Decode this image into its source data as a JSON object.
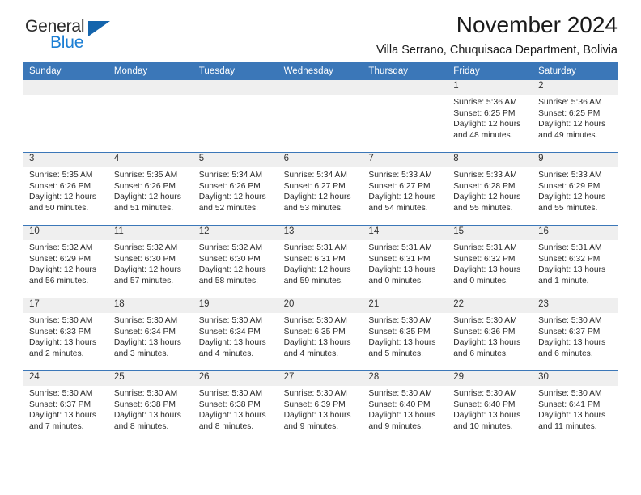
{
  "brand": {
    "name_primary": "General",
    "name_secondary": "Blue",
    "triangle": "triangle-logo-mark"
  },
  "header": {
    "title": "November 2024",
    "subtitle": "Villa Serrano, Chuquisaca Department, Bolivia"
  },
  "colors": {
    "header_blue": "#3b77b8",
    "brand_blue": "#1c7fd4",
    "triangle_blue": "#1464ac",
    "daynum_band": "#efefef",
    "text": "#1a1a1a"
  },
  "calendar": {
    "weekdays": [
      "Sunday",
      "Monday",
      "Tuesday",
      "Wednesday",
      "Thursday",
      "Friday",
      "Saturday"
    ],
    "weeks": [
      [
        {
          "day": "",
          "sunrise": "",
          "sunset": "",
          "daylight1": "",
          "daylight2": "",
          "empty": true
        },
        {
          "day": "",
          "sunrise": "",
          "sunset": "",
          "daylight1": "",
          "daylight2": "",
          "empty": true
        },
        {
          "day": "",
          "sunrise": "",
          "sunset": "",
          "daylight1": "",
          "daylight2": "",
          "empty": true
        },
        {
          "day": "",
          "sunrise": "",
          "sunset": "",
          "daylight1": "",
          "daylight2": "",
          "empty": true
        },
        {
          "day": "",
          "sunrise": "",
          "sunset": "",
          "daylight1": "",
          "daylight2": "",
          "empty": true
        },
        {
          "day": "1",
          "sunrise": "Sunrise: 5:36 AM",
          "sunset": "Sunset: 6:25 PM",
          "daylight1": "Daylight: 12 hours",
          "daylight2": "and 48 minutes."
        },
        {
          "day": "2",
          "sunrise": "Sunrise: 5:36 AM",
          "sunset": "Sunset: 6:25 PM",
          "daylight1": "Daylight: 12 hours",
          "daylight2": "and 49 minutes."
        }
      ],
      [
        {
          "day": "3",
          "sunrise": "Sunrise: 5:35 AM",
          "sunset": "Sunset: 6:26 PM",
          "daylight1": "Daylight: 12 hours",
          "daylight2": "and 50 minutes."
        },
        {
          "day": "4",
          "sunrise": "Sunrise: 5:35 AM",
          "sunset": "Sunset: 6:26 PM",
          "daylight1": "Daylight: 12 hours",
          "daylight2": "and 51 minutes."
        },
        {
          "day": "5",
          "sunrise": "Sunrise: 5:34 AM",
          "sunset": "Sunset: 6:26 PM",
          "daylight1": "Daylight: 12 hours",
          "daylight2": "and 52 minutes."
        },
        {
          "day": "6",
          "sunrise": "Sunrise: 5:34 AM",
          "sunset": "Sunset: 6:27 PM",
          "daylight1": "Daylight: 12 hours",
          "daylight2": "and 53 minutes."
        },
        {
          "day": "7",
          "sunrise": "Sunrise: 5:33 AM",
          "sunset": "Sunset: 6:27 PM",
          "daylight1": "Daylight: 12 hours",
          "daylight2": "and 54 minutes."
        },
        {
          "day": "8",
          "sunrise": "Sunrise: 5:33 AM",
          "sunset": "Sunset: 6:28 PM",
          "daylight1": "Daylight: 12 hours",
          "daylight2": "and 55 minutes."
        },
        {
          "day": "9",
          "sunrise": "Sunrise: 5:33 AM",
          "sunset": "Sunset: 6:29 PM",
          "daylight1": "Daylight: 12 hours",
          "daylight2": "and 55 minutes."
        }
      ],
      [
        {
          "day": "10",
          "sunrise": "Sunrise: 5:32 AM",
          "sunset": "Sunset: 6:29 PM",
          "daylight1": "Daylight: 12 hours",
          "daylight2": "and 56 minutes."
        },
        {
          "day": "11",
          "sunrise": "Sunrise: 5:32 AM",
          "sunset": "Sunset: 6:30 PM",
          "daylight1": "Daylight: 12 hours",
          "daylight2": "and 57 minutes."
        },
        {
          "day": "12",
          "sunrise": "Sunrise: 5:32 AM",
          "sunset": "Sunset: 6:30 PM",
          "daylight1": "Daylight: 12 hours",
          "daylight2": "and 58 minutes."
        },
        {
          "day": "13",
          "sunrise": "Sunrise: 5:31 AM",
          "sunset": "Sunset: 6:31 PM",
          "daylight1": "Daylight: 12 hours",
          "daylight2": "and 59 minutes."
        },
        {
          "day": "14",
          "sunrise": "Sunrise: 5:31 AM",
          "sunset": "Sunset: 6:31 PM",
          "daylight1": "Daylight: 13 hours",
          "daylight2": "and 0 minutes."
        },
        {
          "day": "15",
          "sunrise": "Sunrise: 5:31 AM",
          "sunset": "Sunset: 6:32 PM",
          "daylight1": "Daylight: 13 hours",
          "daylight2": "and 0 minutes."
        },
        {
          "day": "16",
          "sunrise": "Sunrise: 5:31 AM",
          "sunset": "Sunset: 6:32 PM",
          "daylight1": "Daylight: 13 hours",
          "daylight2": "and 1 minute."
        }
      ],
      [
        {
          "day": "17",
          "sunrise": "Sunrise: 5:30 AM",
          "sunset": "Sunset: 6:33 PM",
          "daylight1": "Daylight: 13 hours",
          "daylight2": "and 2 minutes."
        },
        {
          "day": "18",
          "sunrise": "Sunrise: 5:30 AM",
          "sunset": "Sunset: 6:34 PM",
          "daylight1": "Daylight: 13 hours",
          "daylight2": "and 3 minutes."
        },
        {
          "day": "19",
          "sunrise": "Sunrise: 5:30 AM",
          "sunset": "Sunset: 6:34 PM",
          "daylight1": "Daylight: 13 hours",
          "daylight2": "and 4 minutes."
        },
        {
          "day": "20",
          "sunrise": "Sunrise: 5:30 AM",
          "sunset": "Sunset: 6:35 PM",
          "daylight1": "Daylight: 13 hours",
          "daylight2": "and 4 minutes."
        },
        {
          "day": "21",
          "sunrise": "Sunrise: 5:30 AM",
          "sunset": "Sunset: 6:35 PM",
          "daylight1": "Daylight: 13 hours",
          "daylight2": "and 5 minutes."
        },
        {
          "day": "22",
          "sunrise": "Sunrise: 5:30 AM",
          "sunset": "Sunset: 6:36 PM",
          "daylight1": "Daylight: 13 hours",
          "daylight2": "and 6 minutes."
        },
        {
          "day": "23",
          "sunrise": "Sunrise: 5:30 AM",
          "sunset": "Sunset: 6:37 PM",
          "daylight1": "Daylight: 13 hours",
          "daylight2": "and 6 minutes."
        }
      ],
      [
        {
          "day": "24",
          "sunrise": "Sunrise: 5:30 AM",
          "sunset": "Sunset: 6:37 PM",
          "daylight1": "Daylight: 13 hours",
          "daylight2": "and 7 minutes."
        },
        {
          "day": "25",
          "sunrise": "Sunrise: 5:30 AM",
          "sunset": "Sunset: 6:38 PM",
          "daylight1": "Daylight: 13 hours",
          "daylight2": "and 8 minutes."
        },
        {
          "day": "26",
          "sunrise": "Sunrise: 5:30 AM",
          "sunset": "Sunset: 6:38 PM",
          "daylight1": "Daylight: 13 hours",
          "daylight2": "and 8 minutes."
        },
        {
          "day": "27",
          "sunrise": "Sunrise: 5:30 AM",
          "sunset": "Sunset: 6:39 PM",
          "daylight1": "Daylight: 13 hours",
          "daylight2": "and 9 minutes."
        },
        {
          "day": "28",
          "sunrise": "Sunrise: 5:30 AM",
          "sunset": "Sunset: 6:40 PM",
          "daylight1": "Daylight: 13 hours",
          "daylight2": "and 9 minutes."
        },
        {
          "day": "29",
          "sunrise": "Sunrise: 5:30 AM",
          "sunset": "Sunset: 6:40 PM",
          "daylight1": "Daylight: 13 hours",
          "daylight2": "and 10 minutes."
        },
        {
          "day": "30",
          "sunrise": "Sunrise: 5:30 AM",
          "sunset": "Sunset: 6:41 PM",
          "daylight1": "Daylight: 13 hours",
          "daylight2": "and 11 minutes."
        }
      ]
    ]
  }
}
